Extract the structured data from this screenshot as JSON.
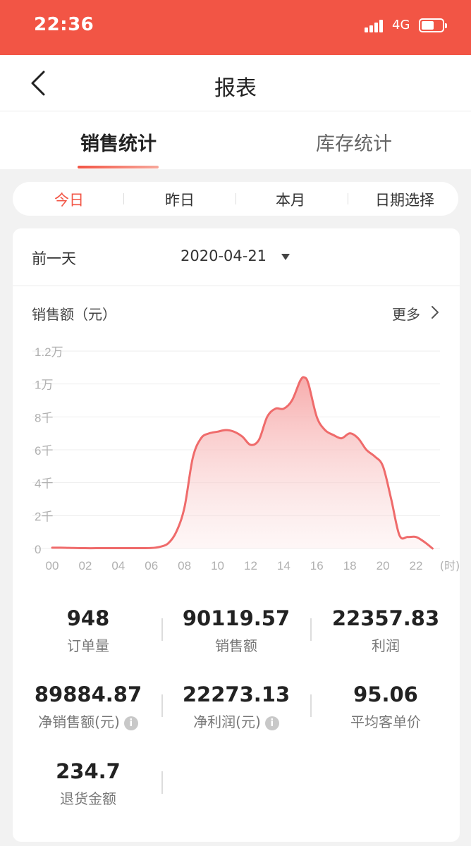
{
  "status_bar": {
    "time": "22:36",
    "network": "4G"
  },
  "nav": {
    "title": "报表"
  },
  "tabs": [
    {
      "label": "销售统计",
      "active": true
    },
    {
      "label": "库存统计",
      "active": false
    }
  ],
  "date_filter": {
    "options": [
      "今日",
      "昨日",
      "本月",
      "日期选择"
    ],
    "selected": "今日"
  },
  "report": {
    "prev_day_label": "前一天",
    "date": "2020-04-21",
    "chart_title": "销售额（元）",
    "more_label": "更多"
  },
  "chart_data": {
    "type": "area",
    "title": "销售额（元）",
    "xlabel": "(时)",
    "ylabel": "",
    "x_ticks": [
      "00",
      "02",
      "04",
      "06",
      "08",
      "10",
      "12",
      "14",
      "16",
      "18",
      "20",
      "22"
    ],
    "y_ticks": [
      "0",
      "2千",
      "4千",
      "6千",
      "8千",
      "1万",
      "1.2万"
    ],
    "ylim": [
      0,
      12000
    ],
    "xlim": [
      0,
      24
    ],
    "grid": true,
    "color": "#ef6b6b",
    "series": [
      {
        "x": [
          0,
          0.5,
          1,
          2,
          3,
          4,
          5,
          6,
          6.5,
          7,
          7.5,
          8,
          8.5,
          9,
          9.5,
          10,
          10.5,
          11,
          11.5,
          12,
          12.5,
          13,
          13.5,
          14,
          14.5,
          15,
          15.25,
          15.5,
          16,
          16.5,
          17,
          17.5,
          18,
          18.5,
          19,
          19.5,
          20,
          20.5,
          21,
          21.5,
          22,
          22.5,
          23
        ],
        "y": [
          50,
          50,
          40,
          20,
          20,
          20,
          20,
          30,
          100,
          300,
          1000,
          2500,
          5500,
          6700,
          7000,
          7100,
          7200,
          7100,
          6800,
          6300,
          6600,
          8000,
          8500,
          8500,
          9000,
          10200,
          10400,
          10000,
          8000,
          7200,
          6900,
          6700,
          7000,
          6700,
          6000,
          5600,
          5000,
          3000,
          800,
          700,
          700,
          400,
          0
        ]
      }
    ]
  },
  "stats": [
    {
      "value": "948",
      "label": "订单量",
      "info": false
    },
    {
      "value": "90119.57",
      "label": "销售额",
      "info": false
    },
    {
      "value": "22357.83",
      "label": "利润",
      "info": false
    },
    {
      "value": "89884.87",
      "label": "净销售额(元)",
      "info": true
    },
    {
      "value": "22273.13",
      "label": "净利润(元)",
      "info": true
    },
    {
      "value": "95.06",
      "label": "平均客单价",
      "info": false
    },
    {
      "value": "234.7",
      "label": "退货金额",
      "info": false
    }
  ],
  "info_glyph": "i"
}
